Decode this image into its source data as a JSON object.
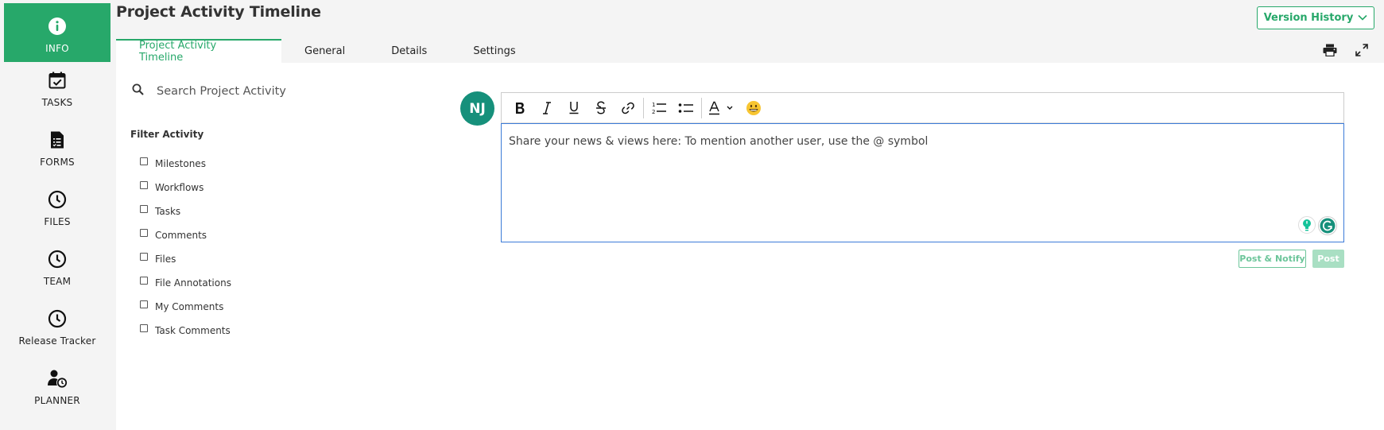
{
  "app": {
    "title": "Project Activity Timeline"
  },
  "header": {
    "version_history_label": "Version History"
  },
  "tabs": [
    {
      "label": "Project Activity Timeline",
      "active": true
    },
    {
      "label": "General",
      "active": false
    },
    {
      "label": "Details",
      "active": false
    },
    {
      "label": "Settings",
      "active": false
    }
  ],
  "sidebar": {
    "items": [
      {
        "label": "INFO",
        "icon": "info-icon",
        "active": true
      },
      {
        "label": "TASKS",
        "icon": "calendar-check-icon",
        "active": false
      },
      {
        "label": "FORMS",
        "icon": "form-icon",
        "active": false
      },
      {
        "label": "FILES",
        "icon": "clock-icon",
        "active": false
      },
      {
        "label": "TEAM",
        "icon": "clock-icon",
        "active": false
      },
      {
        "label": "Release Tracker",
        "icon": "clock-icon",
        "active": false
      },
      {
        "label": "PLANNER",
        "icon": "user-clock-icon",
        "active": false
      }
    ]
  },
  "search": {
    "placeholder": "Search Project Activity",
    "value": ""
  },
  "filter": {
    "title": "Filter Activity",
    "options": [
      {
        "label": "Milestones",
        "checked": false
      },
      {
        "label": "Workflows",
        "checked": false
      },
      {
        "label": "Tasks",
        "checked": false
      },
      {
        "label": "Comments",
        "checked": false
      },
      {
        "label": "Files",
        "checked": false
      },
      {
        "label": "File Annotations",
        "checked": false
      },
      {
        "label": "My Comments",
        "checked": false
      },
      {
        "label": "Task Comments",
        "checked": false
      }
    ]
  },
  "composer": {
    "avatar_initials": "NJ",
    "placeholder": "Share your news & views here:  To mention another user, use the @ symbol",
    "toolbar": [
      "bold-icon",
      "italic-icon",
      "underline-icon",
      "strikethrough-icon",
      "link-icon",
      "ordered-list-icon",
      "bullet-list-icon",
      "text-color-icon",
      "emoji-icon"
    ],
    "post_notify_label": "Post & Notify",
    "post_label": "Post"
  },
  "colors": {
    "accent": "#27a86a",
    "avatar": "#16907b",
    "editor_focus": "#3c7bd8"
  }
}
